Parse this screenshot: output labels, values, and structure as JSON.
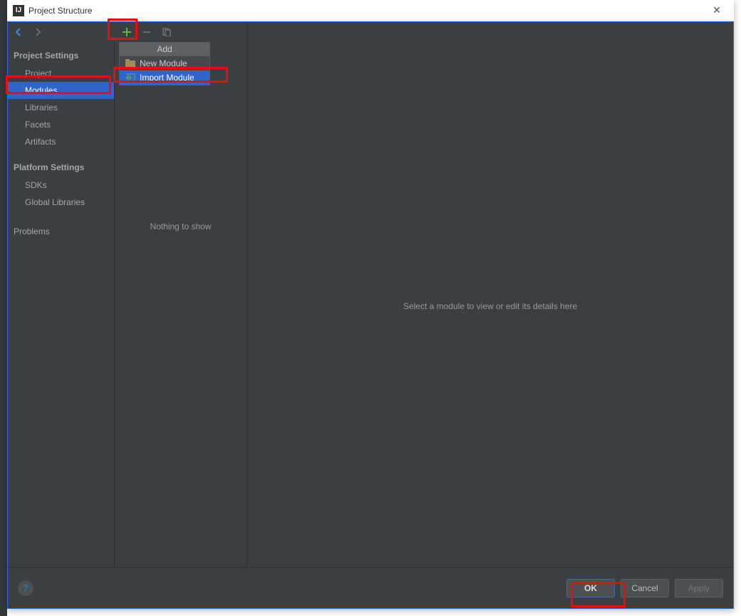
{
  "titlebar": {
    "title": "Project Structure"
  },
  "sidebar": {
    "section1_title": "Project Settings",
    "items1": [
      "Project",
      "Modules",
      "Libraries",
      "Facets",
      "Artifacts"
    ],
    "section2_title": "Platform Settings",
    "items2": [
      "SDKs",
      "Global Libraries"
    ],
    "problems": "Problems"
  },
  "middle": {
    "nothing": "Nothing to show"
  },
  "main": {
    "placeholder": "Select a module to view or edit its details here"
  },
  "popup": {
    "title": "Add",
    "items": [
      {
        "label": "New Module",
        "icon": "folder"
      },
      {
        "label": "Import Module",
        "icon": "import"
      }
    ]
  },
  "buttons": {
    "ok": "OK",
    "cancel": "Cancel",
    "apply": "Apply"
  }
}
